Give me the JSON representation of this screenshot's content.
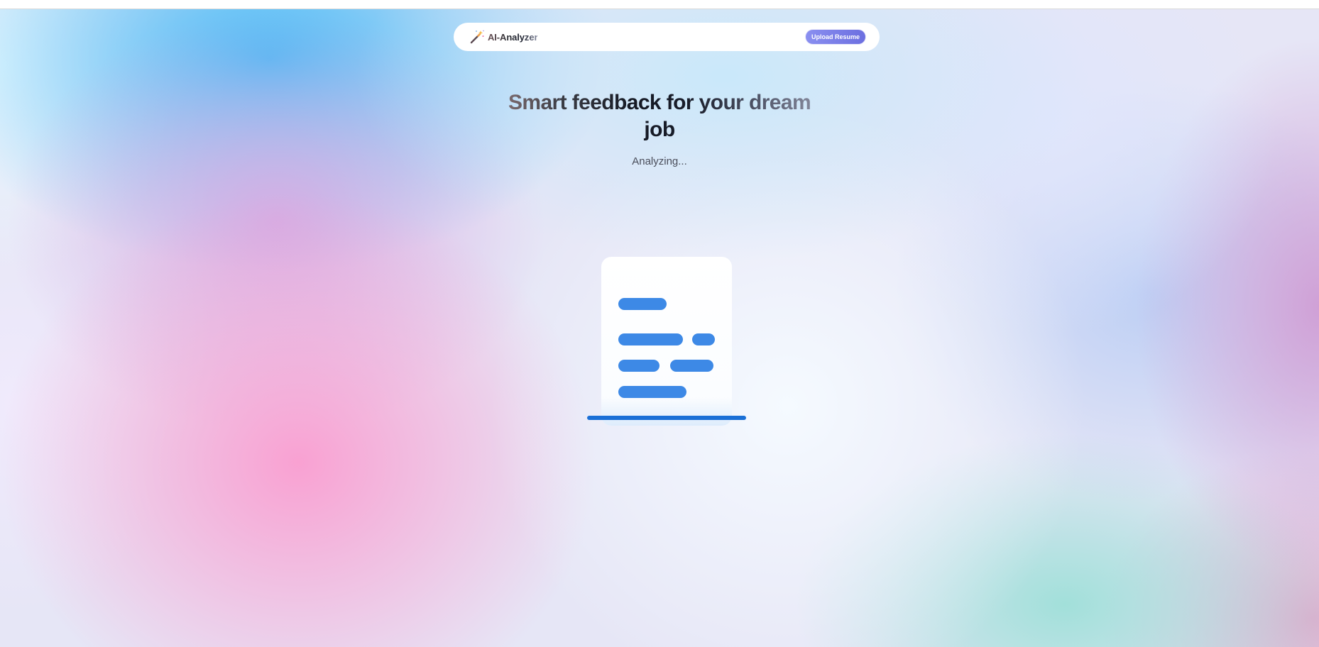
{
  "header": {
    "brand": "AI-Analyzer",
    "brand_icon": "magic-wand-icon",
    "upload_label": "Upload Resume"
  },
  "hero": {
    "title": "Smart feedback for your dream job",
    "status": "Analyzing..."
  },
  "scan_illustration": {
    "icon": "resume-document-icon",
    "accent_color": "#3d89e6",
    "scan_bar_color": "#1a6fd6"
  },
  "colors": {
    "button_gradient_start": "#8a8ff0",
    "button_gradient_end": "#6c6fe0"
  }
}
